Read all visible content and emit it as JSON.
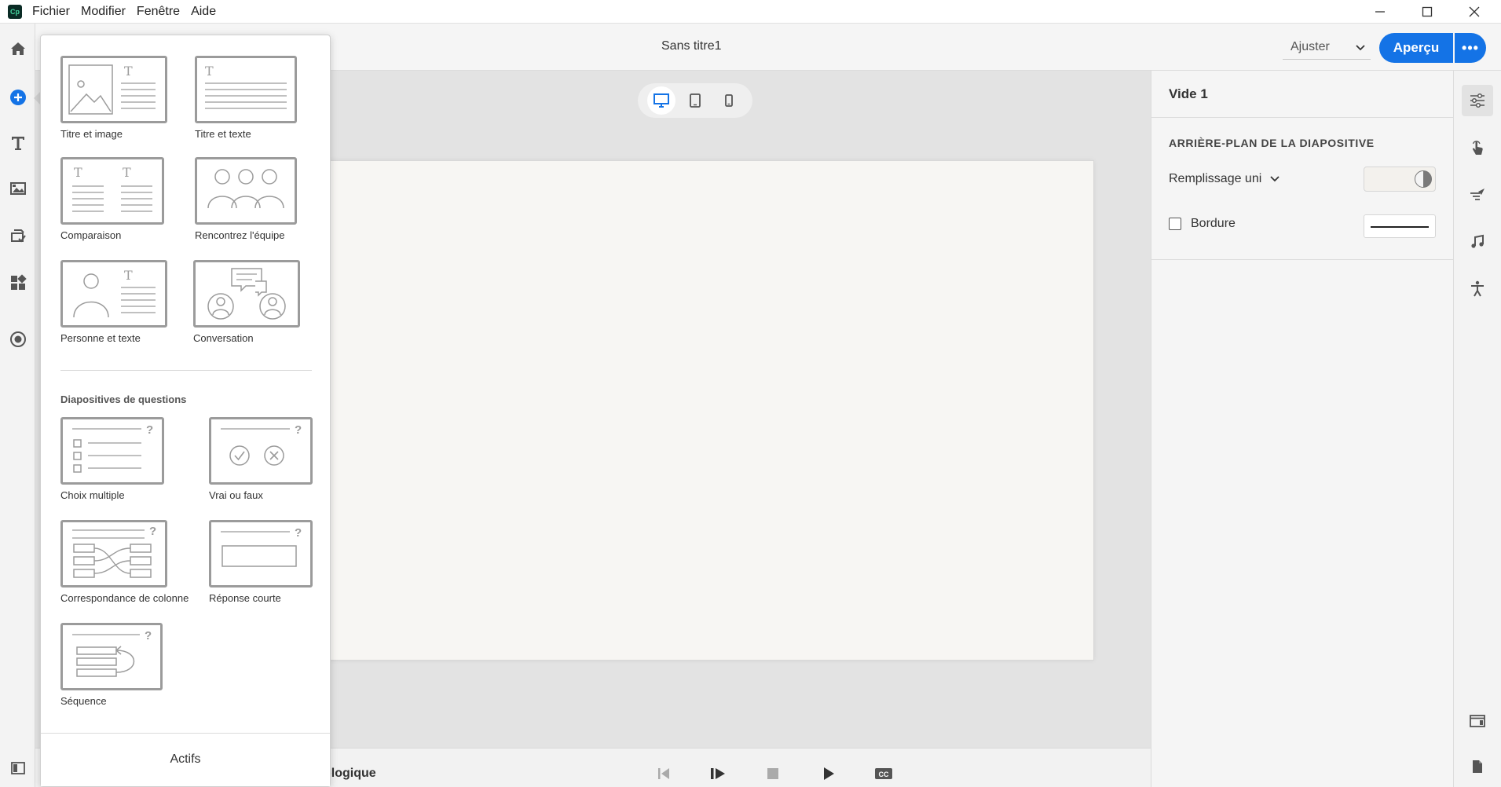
{
  "menubar": {
    "logo_text": "Cp",
    "items": [
      "Fichier",
      "Modifier",
      "Fenêtre",
      "Aide"
    ]
  },
  "header": {
    "doc_title": "Sans titre1",
    "zoom": "Ajuster",
    "preview_label": "Aperçu",
    "more_label": "•••"
  },
  "device_switch": {
    "active": "desktop"
  },
  "bottom_bar": {
    "timeline_label": "ologique"
  },
  "properties": {
    "title": "Vide 1",
    "background_heading": "ARRIÈRE-PLAN DE LA DIAPOSITIVE",
    "fill_label": "Remplissage uni",
    "border_label": "Bordure",
    "border_checked": false
  },
  "flyout": {
    "templates": [
      "Titre et image",
      "Titre et texte",
      "Comparaison",
      "Rencontrez l'équipe",
      "Personne et texte",
      "Conversation"
    ],
    "questions_heading": "Diapositives de questions",
    "questions": [
      "Choix multiple",
      "Vrai ou faux",
      "Correspondance de colonne",
      "Réponse courte",
      "Séquence"
    ],
    "assets_label": "Actifs"
  },
  "colors": {
    "accent": "#1473e6",
    "slide_background": "#f7f6f3",
    "thumb_border": "#9b9b9b"
  }
}
